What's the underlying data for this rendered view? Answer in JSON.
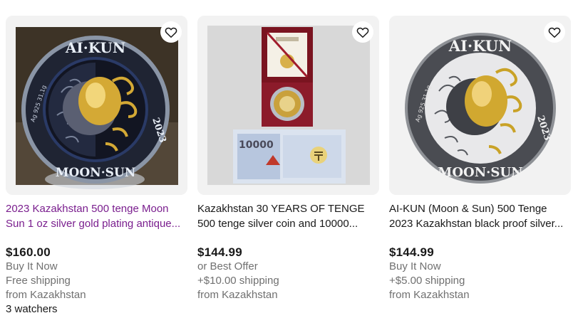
{
  "listings": [
    {
      "title_line1": "2023 Kazakhstan 500 tenge Moon",
      "title_line2": "Sun 1 oz silver gold plating antique...",
      "price": "$160.00",
      "buy_format": "Buy It Now",
      "shipping": "Free shipping",
      "location": "from Kazakhstan",
      "watchers": "3 watchers",
      "coin_top_text": "AI·KUN",
      "coin_bottom_text": "MOON·SUN",
      "coin_year": "2023",
      "coin_left_text": "Ag 925 31,1g"
    },
    {
      "title_line1": "Kazakhstan 30 YEARS OF TENGE",
      "title_line2": "500 tenge silver coin and 10000...",
      "price": "$144.99",
      "buy_format": "or Best Offer",
      "shipping": "+$10.00 shipping",
      "location": "from Kazakhstan",
      "banknote_number": "10000"
    },
    {
      "title_line1": "AI-KUN (Moon & Sun) 500 Tenge",
      "title_line2": "2023 Kazakhstan black proof silver...",
      "price": "$144.99",
      "buy_format": "Buy It Now",
      "shipping": "+$5.00 shipping",
      "location": "from Kazakhstan",
      "coin_top_text": "AI·KUN",
      "coin_bottom_text": "MOON·SUN",
      "coin_year": "2023",
      "coin_left_text": "Ag 925 31,1g"
    }
  ],
  "colors": {
    "visited_link": "#7a1e8e",
    "secondary_text": "#707070",
    "gold": "#d4a935",
    "card_bg": "#f2f2f2"
  }
}
